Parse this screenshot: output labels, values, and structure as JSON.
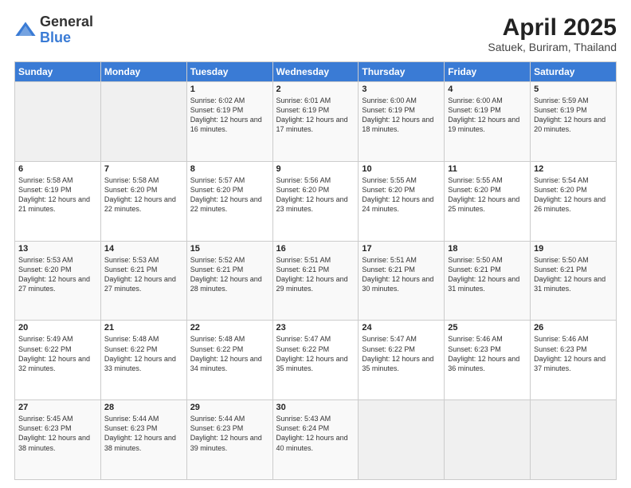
{
  "header": {
    "logo_general": "General",
    "logo_blue": "Blue",
    "title": "April 2025",
    "subtitle": "Satuek, Buriram, Thailand"
  },
  "days_of_week": [
    "Sunday",
    "Monday",
    "Tuesday",
    "Wednesday",
    "Thursday",
    "Friday",
    "Saturday"
  ],
  "weeks": [
    [
      {
        "day": "",
        "info": ""
      },
      {
        "day": "",
        "info": ""
      },
      {
        "day": "1",
        "info": "Sunrise: 6:02 AM\nSunset: 6:19 PM\nDaylight: 12 hours and 16 minutes."
      },
      {
        "day": "2",
        "info": "Sunrise: 6:01 AM\nSunset: 6:19 PM\nDaylight: 12 hours and 17 minutes."
      },
      {
        "day": "3",
        "info": "Sunrise: 6:00 AM\nSunset: 6:19 PM\nDaylight: 12 hours and 18 minutes."
      },
      {
        "day": "4",
        "info": "Sunrise: 6:00 AM\nSunset: 6:19 PM\nDaylight: 12 hours and 19 minutes."
      },
      {
        "day": "5",
        "info": "Sunrise: 5:59 AM\nSunset: 6:19 PM\nDaylight: 12 hours and 20 minutes."
      }
    ],
    [
      {
        "day": "6",
        "info": "Sunrise: 5:58 AM\nSunset: 6:19 PM\nDaylight: 12 hours and 21 minutes."
      },
      {
        "day": "7",
        "info": "Sunrise: 5:58 AM\nSunset: 6:20 PM\nDaylight: 12 hours and 22 minutes."
      },
      {
        "day": "8",
        "info": "Sunrise: 5:57 AM\nSunset: 6:20 PM\nDaylight: 12 hours and 22 minutes."
      },
      {
        "day": "9",
        "info": "Sunrise: 5:56 AM\nSunset: 6:20 PM\nDaylight: 12 hours and 23 minutes."
      },
      {
        "day": "10",
        "info": "Sunrise: 5:55 AM\nSunset: 6:20 PM\nDaylight: 12 hours and 24 minutes."
      },
      {
        "day": "11",
        "info": "Sunrise: 5:55 AM\nSunset: 6:20 PM\nDaylight: 12 hours and 25 minutes."
      },
      {
        "day": "12",
        "info": "Sunrise: 5:54 AM\nSunset: 6:20 PM\nDaylight: 12 hours and 26 minutes."
      }
    ],
    [
      {
        "day": "13",
        "info": "Sunrise: 5:53 AM\nSunset: 6:20 PM\nDaylight: 12 hours and 27 minutes."
      },
      {
        "day": "14",
        "info": "Sunrise: 5:53 AM\nSunset: 6:21 PM\nDaylight: 12 hours and 27 minutes."
      },
      {
        "day": "15",
        "info": "Sunrise: 5:52 AM\nSunset: 6:21 PM\nDaylight: 12 hours and 28 minutes."
      },
      {
        "day": "16",
        "info": "Sunrise: 5:51 AM\nSunset: 6:21 PM\nDaylight: 12 hours and 29 minutes."
      },
      {
        "day": "17",
        "info": "Sunrise: 5:51 AM\nSunset: 6:21 PM\nDaylight: 12 hours and 30 minutes."
      },
      {
        "day": "18",
        "info": "Sunrise: 5:50 AM\nSunset: 6:21 PM\nDaylight: 12 hours and 31 minutes."
      },
      {
        "day": "19",
        "info": "Sunrise: 5:50 AM\nSunset: 6:21 PM\nDaylight: 12 hours and 31 minutes."
      }
    ],
    [
      {
        "day": "20",
        "info": "Sunrise: 5:49 AM\nSunset: 6:22 PM\nDaylight: 12 hours and 32 minutes."
      },
      {
        "day": "21",
        "info": "Sunrise: 5:48 AM\nSunset: 6:22 PM\nDaylight: 12 hours and 33 minutes."
      },
      {
        "day": "22",
        "info": "Sunrise: 5:48 AM\nSunset: 6:22 PM\nDaylight: 12 hours and 34 minutes."
      },
      {
        "day": "23",
        "info": "Sunrise: 5:47 AM\nSunset: 6:22 PM\nDaylight: 12 hours and 35 minutes."
      },
      {
        "day": "24",
        "info": "Sunrise: 5:47 AM\nSunset: 6:22 PM\nDaylight: 12 hours and 35 minutes."
      },
      {
        "day": "25",
        "info": "Sunrise: 5:46 AM\nSunset: 6:23 PM\nDaylight: 12 hours and 36 minutes."
      },
      {
        "day": "26",
        "info": "Sunrise: 5:46 AM\nSunset: 6:23 PM\nDaylight: 12 hours and 37 minutes."
      }
    ],
    [
      {
        "day": "27",
        "info": "Sunrise: 5:45 AM\nSunset: 6:23 PM\nDaylight: 12 hours and 38 minutes."
      },
      {
        "day": "28",
        "info": "Sunrise: 5:44 AM\nSunset: 6:23 PM\nDaylight: 12 hours and 38 minutes."
      },
      {
        "day": "29",
        "info": "Sunrise: 5:44 AM\nSunset: 6:23 PM\nDaylight: 12 hours and 39 minutes."
      },
      {
        "day": "30",
        "info": "Sunrise: 5:43 AM\nSunset: 6:24 PM\nDaylight: 12 hours and 40 minutes."
      },
      {
        "day": "",
        "info": ""
      },
      {
        "day": "",
        "info": ""
      },
      {
        "day": "",
        "info": ""
      }
    ]
  ]
}
